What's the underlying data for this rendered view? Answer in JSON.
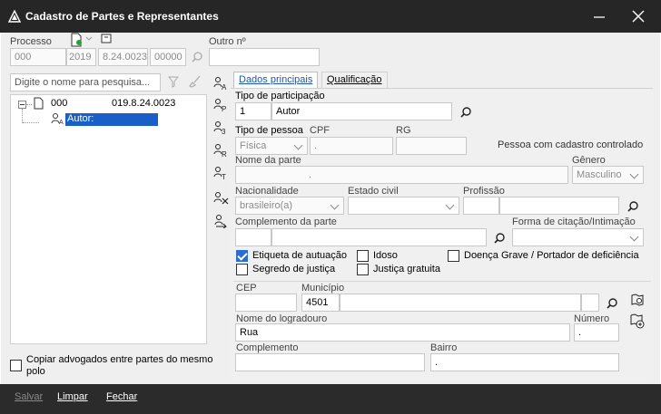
{
  "window": {
    "title": "Cadastro de Partes e Representantes"
  },
  "processo": {
    "label": "Processo",
    "part1": "000",
    "part2": "2019",
    "part3": "8.24.0023",
    "part4": "00000",
    "outro_label": "Outro nº",
    "outro_value": ""
  },
  "search": {
    "placeholder": "Digite o nome para pesquisa..."
  },
  "tree": {
    "root_num": "000",
    "root_proc": "019.8.24.0023",
    "child_label": "Autor:"
  },
  "tabs": [
    {
      "label": "Dados principais"
    },
    {
      "label": "Qualificação"
    }
  ],
  "form": {
    "tipo_participacao_label": "Tipo de participação",
    "tipo_participacao_code": "1",
    "tipo_participacao_value": "Autor",
    "tipo_pessoa_label": "Tipo de pessoa",
    "tipo_pessoa_value": "Física",
    "cpf_label": "CPF",
    "cpf_value": ".",
    "rg_label": "RG",
    "rg_value": "",
    "controlado_label": "Pessoa com cadastro controlado",
    "nome_label": "Nome da parte",
    "nome_value": ".",
    "genero_label": "Gênero",
    "genero_value": "Masculino",
    "nacionalidade_label": "Nacionalidade",
    "nacionalidade_value": "brasileiro(a)",
    "estado_civil_label": "Estado civil",
    "estado_civil_value": "",
    "profissao_label": "Profissão",
    "profissao_value": "",
    "complemento_parte_label": "Complemento da parte",
    "complemento_parte_value": "",
    "forma_citacao_label": "Forma de citação/Intimação",
    "forma_citacao_value": "",
    "etiqueta_label": "Etiqueta de autuação",
    "etiqueta_checked": true,
    "idoso_label": "Idoso",
    "idoso_checked": false,
    "doenca_label": "Doença Grave / Portador de deficiência",
    "doenca_checked": false,
    "segredo_label": "Segredo de justiça",
    "segredo_checked": false,
    "justica_label": "Justiça gratuita",
    "justica_checked": false,
    "cep_label": "CEP",
    "cep_value": "",
    "municipio_label": "Município",
    "municipio_code": "4501",
    "municipio_value": "",
    "logradouro_label": "Nome do logradouro",
    "logradouro_value": "Rua",
    "numero_label": "Número",
    "numero_value": ".",
    "complemento_label": "Complemento",
    "complemento_value": "",
    "bairro_label": "Bairro",
    "bairro_value": "."
  },
  "copiar": {
    "label": "Copiar advogados entre partes do mesmo polo",
    "checked": false
  },
  "footer": {
    "salvar": "Salvar",
    "limpar": "Limpar",
    "fechar": "Fechar"
  },
  "side_buttons": [
    "A",
    "P",
    "3",
    "R",
    "T"
  ],
  "colors": {
    "titlebar": "#262626",
    "accent": "#1a56b8",
    "footer": "#2b2b2b"
  }
}
